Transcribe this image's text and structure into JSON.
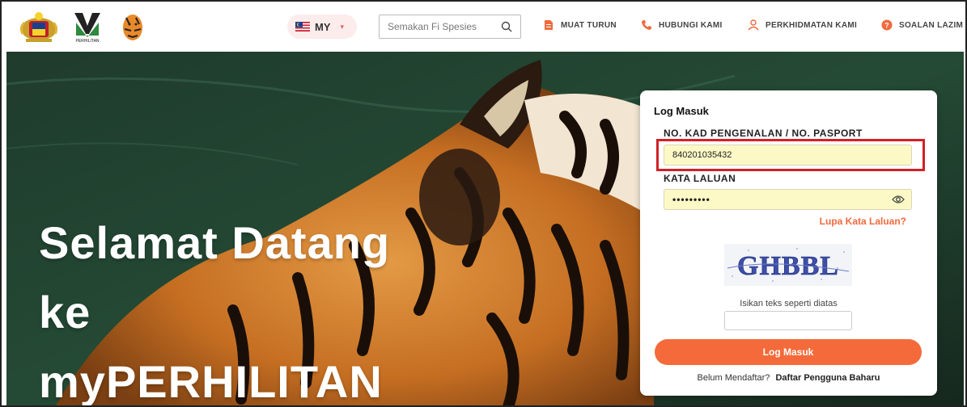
{
  "nav": {
    "language_code": "MY",
    "search_placeholder": "Semakan Fi Spesies",
    "links": {
      "muat_turun": "MUAT TURUN",
      "hubungi_kami": "HUBUNGI KAMI",
      "perkhidmatan_kami": "PERKHIDMATAN KAMI",
      "soalan_lazim": "SOALAN LAZIM"
    },
    "logo_text": "PERHILITAN"
  },
  "hero": {
    "line1": "Selamat Datang",
    "line2": "ke",
    "line3": "myPERHILITAN"
  },
  "login": {
    "title": "Log Masuk",
    "ic_label": "NO. KAD PENGENALAN / NO. PASPORT",
    "ic_value": "840201035432",
    "password_label": "KATA LALUAN",
    "password_value": "•••••••••",
    "forgot_link": "Lupa Kata Laluan?",
    "captcha_text": "GHBBL",
    "captcha_hint": "Isikan teks seperti diatas",
    "submit_label": "Log Masuk",
    "register_prompt": "Belum Mendaftar?",
    "register_link": "Daftar Pengguna Baharu"
  },
  "colors": {
    "accent": "#f46a3a",
    "highlight": "#d32027",
    "field_bg": "#fcf9c6",
    "nav_icon_orange": "#f06a3e"
  },
  "icons": [
    "malaysia-flag-icon",
    "search-icon",
    "document-icon",
    "phone-icon",
    "person-service-icon",
    "question-icon",
    "eye-icon"
  ]
}
